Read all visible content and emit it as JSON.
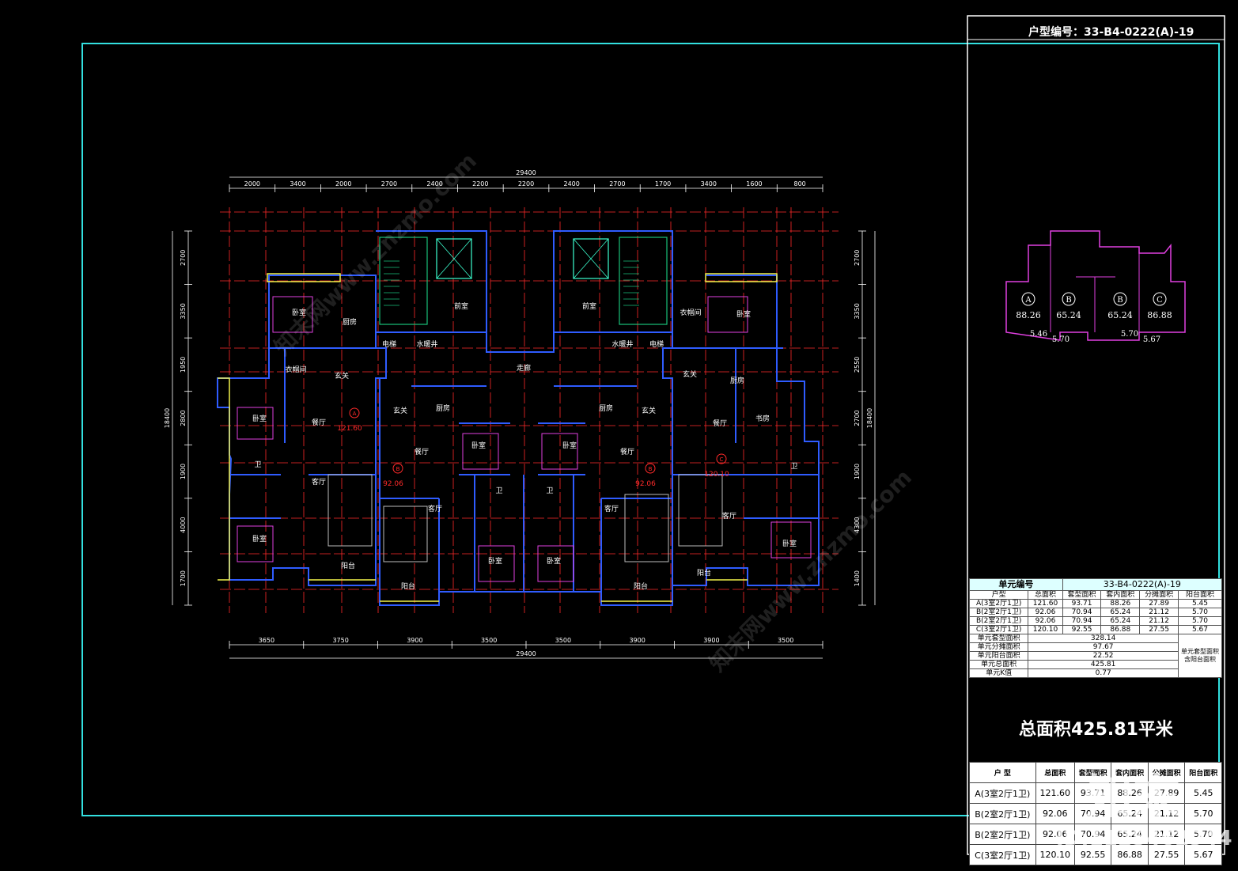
{
  "header": {
    "type_code_label": "户型编号：33-B4-0222(A)-19"
  },
  "dimensions": {
    "top_total": "29400",
    "top_segments": [
      "2000",
      "3400",
      "2000",
      "2700",
      "2400",
      "2200",
      "2200",
      "2400",
      "2700",
      "1700",
      "3400",
      "1600",
      "800"
    ],
    "bottom_total": "29400",
    "bottom_segments": [
      "3650",
      "3750",
      "3900",
      "3500",
      "3500",
      "3900",
      "3900",
      "3500"
    ],
    "left_total": "18400",
    "left_segments": [
      "2700",
      "3350",
      "1950",
      "2800",
      "1900",
      "4000",
      "1700"
    ],
    "right_total": "18400",
    "right_segments": [
      "2700",
      "3350",
      "2550",
      "2700",
      "1900",
      "4300",
      "1400"
    ]
  },
  "rooms": {
    "bedroom": "卧室",
    "kitchen": "厨房",
    "foyer": "玄关",
    "dining": "餐厅",
    "living": "客厅",
    "bath": "卫",
    "balcony": "阳台",
    "study": "书房",
    "closet": "衣帽间",
    "corridor": "走廊",
    "stair": "前室",
    "elevator": "电梯",
    "shaft": "水暖井"
  },
  "unit_labels": [
    {
      "letter": "A",
      "area": "121.60"
    },
    {
      "letter": "B",
      "area": "92.06"
    },
    {
      "letter": "B",
      "area": "92.06"
    },
    {
      "letter": "C",
      "area": "120.10"
    }
  ],
  "key_plan": {
    "units": [
      {
        "letter": "A",
        "area": "88.26",
        "balcony": "5.46"
      },
      {
        "letter": "B",
        "area": "65.24",
        "balcony": "5.70"
      },
      {
        "letter": "B",
        "area": "65.24",
        "balcony": "5.70"
      },
      {
        "letter": "C",
        "area": "86.88",
        "balcony": "5.67"
      }
    ]
  },
  "unit_table": {
    "head_label": "单元编号",
    "head_value": "33-B4-0222(A)-19",
    "columns": [
      "户型",
      "总面积",
      "套型面积",
      "套内面积",
      "分摊面积",
      "阳台面积"
    ],
    "rows": [
      [
        "A(3室2厅1卫)",
        "121.60",
        "93.71",
        "88.26",
        "27.89",
        "5.45"
      ],
      [
        "B(2室2厅1卫)",
        "92.06",
        "70.94",
        "65.24",
        "21.12",
        "5.70"
      ],
      [
        "B(2室2厅1卫)",
        "92.06",
        "70.94",
        "65.24",
        "21.12",
        "5.70"
      ],
      [
        "C(3室2厅1卫)",
        "120.10",
        "92.55",
        "86.88",
        "27.55",
        "5.67"
      ]
    ],
    "summary": [
      [
        "单元套型面积",
        "328.14"
      ],
      [
        "单元分摊面积",
        "97.67"
      ],
      [
        "单元阳台面积",
        "22.52"
      ],
      [
        "单元总面积",
        "425.81"
      ],
      [
        "单元K值",
        "0.77"
      ]
    ],
    "note": "单元套型面积 含阳台面积"
  },
  "total_area": "总面积425.81平米",
  "bottom_table": {
    "columns": [
      "户 型",
      "总面积",
      "套型面积",
      "套内面积",
      "公摊面积",
      "阳台面积"
    ],
    "rows": [
      [
        "A(3室2厅1卫)",
        "121.60",
        "93.71",
        "88.26",
        "27.89",
        "5.45"
      ],
      [
        "B(2室2厅1卫)",
        "92.06",
        "70.94",
        "65.24",
        "21.12",
        "5.70"
      ],
      [
        "B(2室2厅1卫)",
        "92.06",
        "70.94",
        "65.24",
        "21.12",
        "5.70"
      ],
      [
        "C(3室2厅1卫)",
        "120.10",
        "92.55",
        "86.88",
        "27.55",
        "5.67"
      ]
    ]
  },
  "watermark": {
    "brand": "知末",
    "id": "ID:1125462944",
    "site": "知末网www.znzmo.com"
  },
  "colors": {
    "frame": "#33e0e0",
    "wall": "#2f5cff",
    "grid_red": "#ff2a2a",
    "dim_white": "#ffffff",
    "magenta": "#e040e0",
    "yellow": "#f2f24a",
    "cyan": "#3cffd0",
    "green": "#19c27a"
  }
}
